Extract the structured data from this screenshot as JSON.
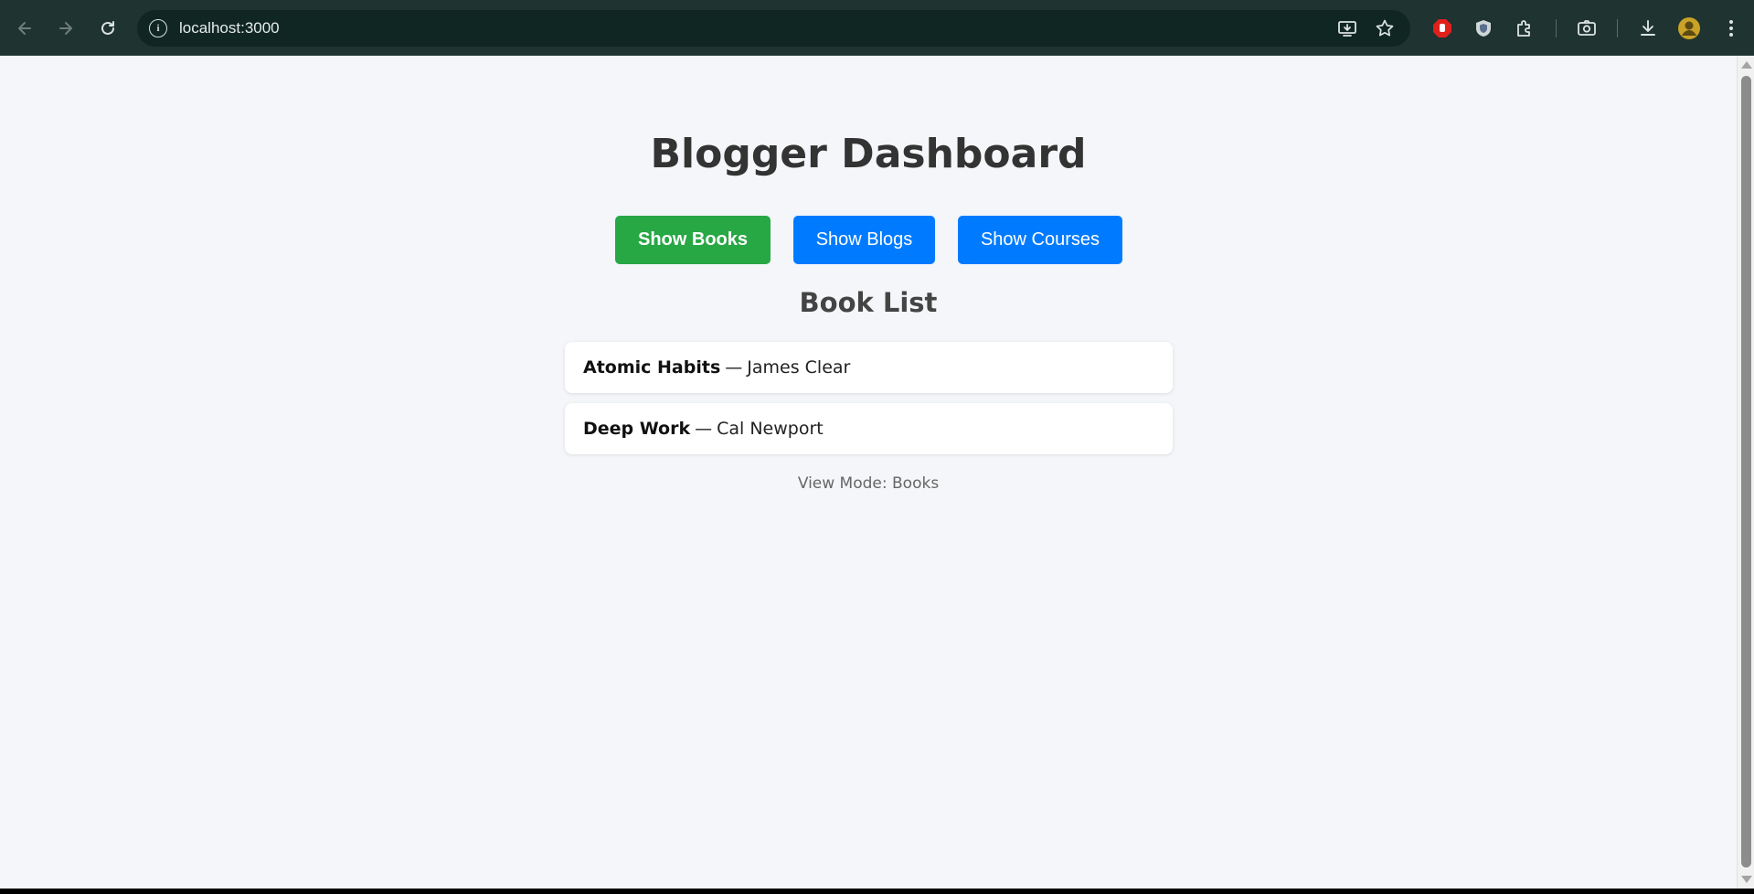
{
  "browser": {
    "url": "localhost:3000"
  },
  "page": {
    "title": "Blogger Dashboard",
    "buttons": {
      "books": "Show Books",
      "blogs": "Show Blogs",
      "courses": "Show Courses"
    },
    "section_title": "Book List",
    "books": [
      {
        "title": "Atomic Habits",
        "separator": "—",
        "author": "James Clear"
      },
      {
        "title": "Deep Work",
        "separator": "—",
        "author": "Cal Newport"
      }
    ],
    "view_mode": "View Mode: Books"
  },
  "colors": {
    "active_button": "#28a745",
    "inactive_button": "#007bff",
    "browser_frame": "#1f3331"
  }
}
